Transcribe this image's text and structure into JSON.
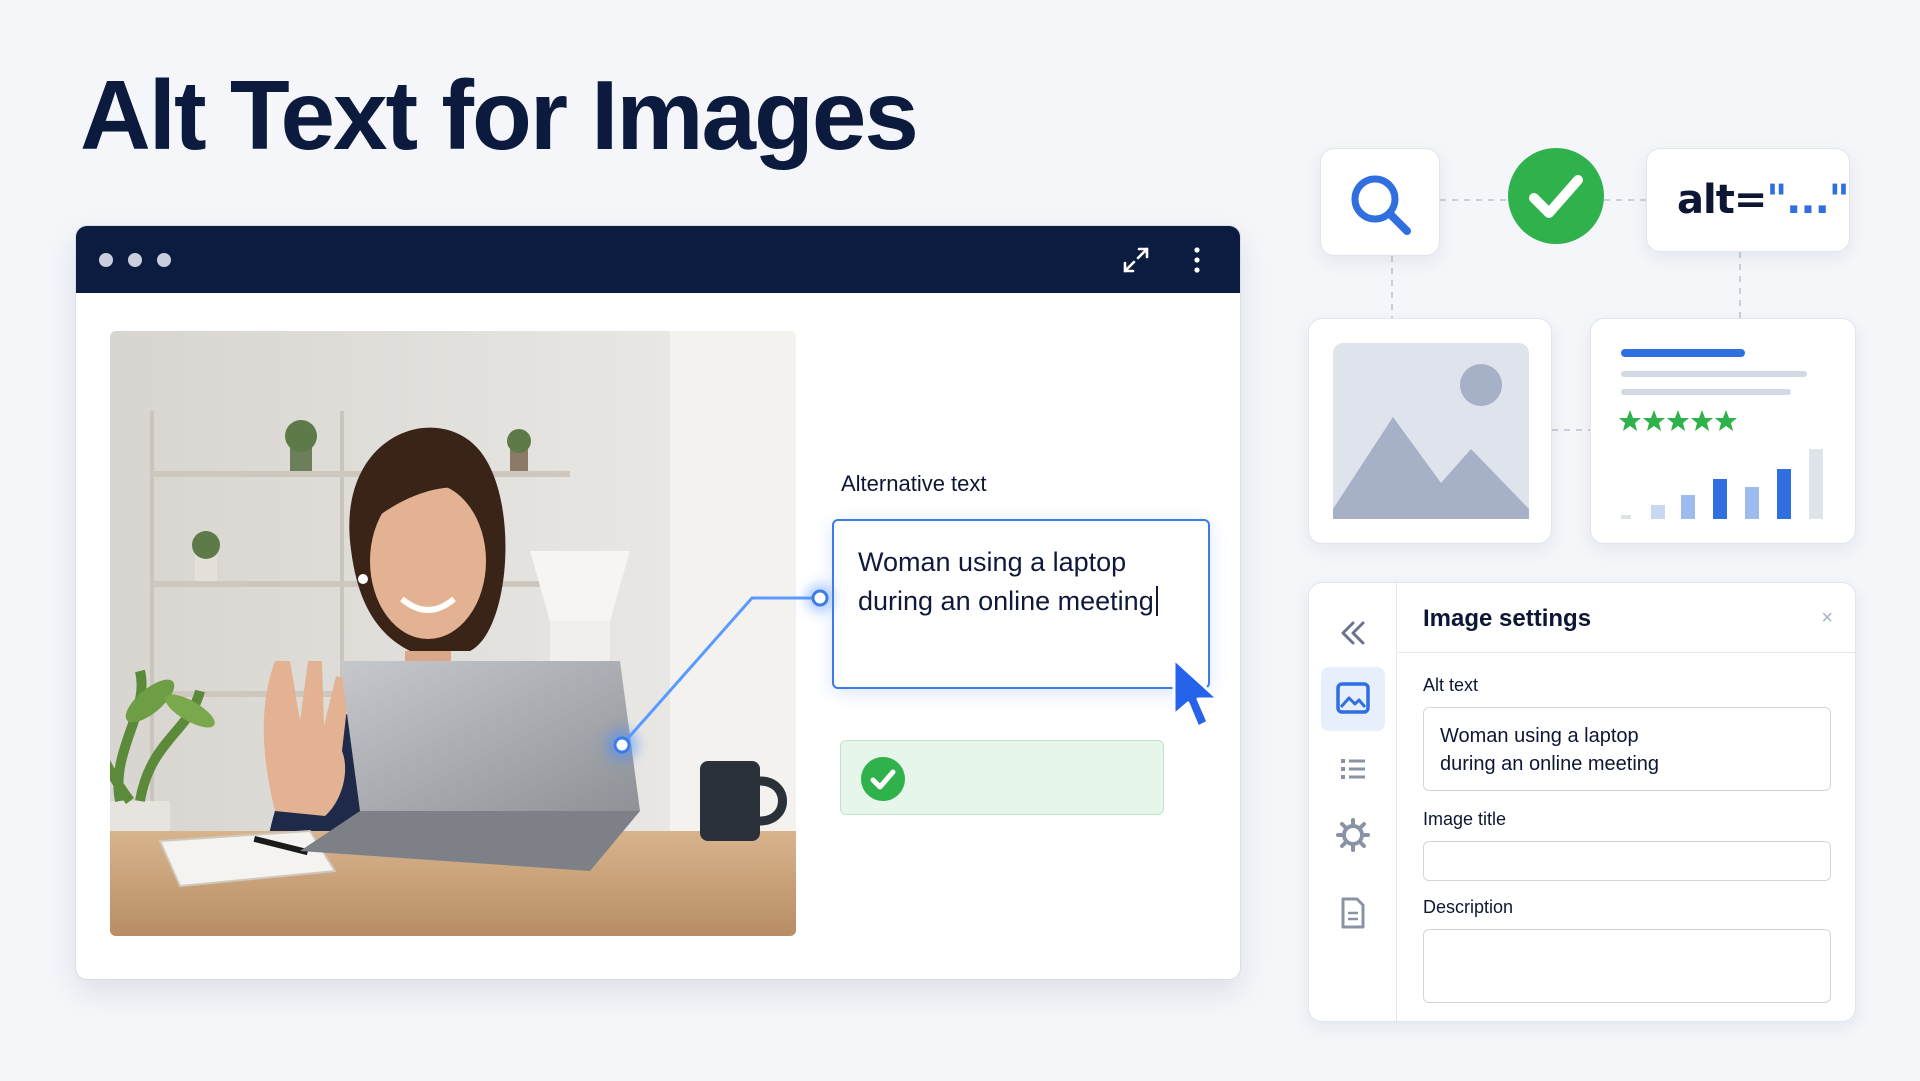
{
  "title": "Alt Text for Images",
  "editor": {
    "field_label": "Alternative text",
    "field_value_line1": "Woman using a laptop",
    "field_value_line2": "during an online meeting"
  },
  "badges": {
    "alt_attribute_prefix": "alt=",
    "alt_attribute_value": "\"...\""
  },
  "rating": {
    "stars": 5
  },
  "settings_panel": {
    "title": "Image settings",
    "close": "×",
    "alt_text_label": "Alt text",
    "alt_text_line1": "Woman using a laptop",
    "alt_text_line2": "during an online meeting",
    "image_title_label": "Image title",
    "image_title_value": "",
    "description_label": "Description",
    "description_value": ""
  },
  "icons": {
    "window_controls": "dots",
    "expand": "expand-icon",
    "menu": "kebab-menu-icon",
    "search": "search-icon",
    "check": "check-circle-icon",
    "rail": [
      "collapse-icon",
      "image-icon",
      "list-icon",
      "gear-icon",
      "document-icon"
    ]
  },
  "colors": {
    "accent": "#3b7ce8",
    "success": "#2fb14b",
    "navy": "#0c1b40"
  }
}
